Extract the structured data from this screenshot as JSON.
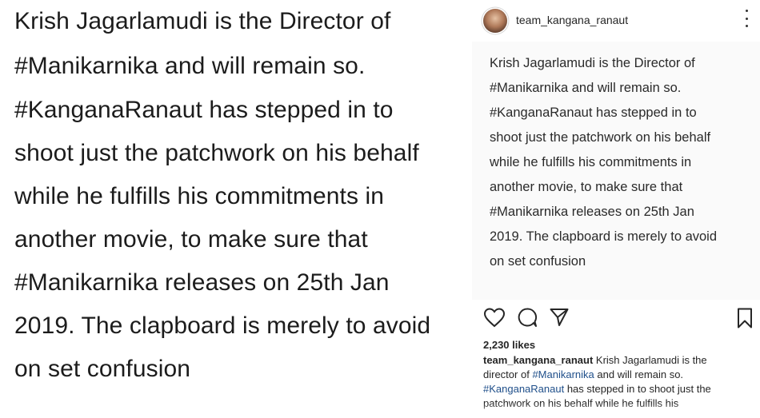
{
  "quote": {
    "lines": [
      "Krish Jagarlamudi is the Director of",
      "#Manikarnika and will remain so.",
      "#KanganaRanaut has stepped in to",
      "shoot just the patchwork on his behalf",
      "while he fulfills his commitments in",
      "another movie, to make sure that",
      "#Manikarnika releases on 25th Jan",
      "2019. The clapboard is merely to avoid",
      "on set confusion"
    ]
  },
  "instagram": {
    "username": "team_kangana_ranaut",
    "post_lines": [
      "Krish Jagarlamudi is the Director of",
      "#Manikarnika and will remain so.",
      "#KanganaRanaut has stepped in to",
      "shoot just the patchwork on his behalf",
      "while he fulfills his commitments in",
      "another movie, to make sure that",
      "#Manikarnika releases on 25th Jan",
      "2019. The clapboard is merely to avoid",
      "on set confusion"
    ],
    "likes": "2,230 likes",
    "caption": {
      "username": "team_kangana_ranaut",
      "line1_rest": "Krish Jagarlamudi is the",
      "line2_pre": "director of",
      "line2_tag": "#Manikarnika",
      "line2_post": "and will remain so.",
      "line3_tag": "#KanganaRanaut",
      "line3_post": "has stepped in to shoot just the",
      "line4": "patchwork on his behalf while he fulfills his"
    },
    "icons": [
      "more-icon",
      "heart-icon",
      "comment-icon",
      "share-icon",
      "bookmark-icon"
    ]
  }
}
